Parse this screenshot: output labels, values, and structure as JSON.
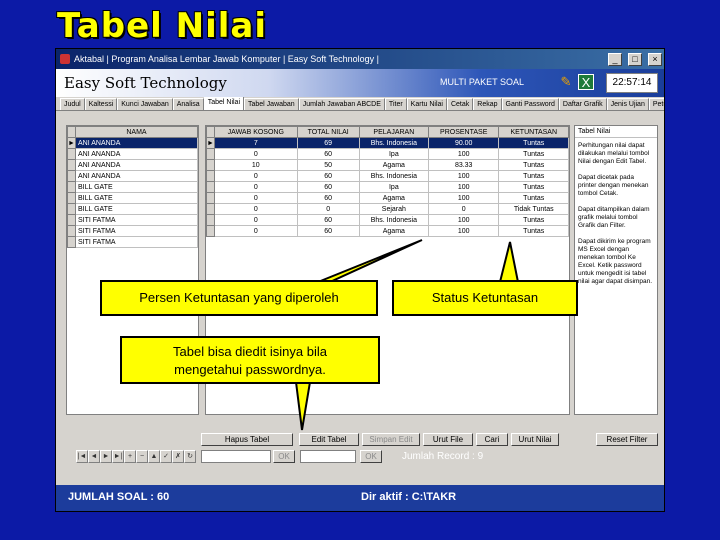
{
  "slide": {
    "title": "Tabel Nilai"
  },
  "window": {
    "title": "Aktabal | Program Analisa Lembar Jawab Komputer | Easy Soft Technology |",
    "minimize": "_",
    "maximize": "□",
    "close": "×"
  },
  "banner": {
    "brand": "Easy Soft Technology",
    "product": "MULTI PAKET SOAL",
    "clock": "22:57:14"
  },
  "tabs": [
    "Judul",
    "Kaltessi",
    "Kunci Jawaban",
    "Analisa",
    "Tabel Nilai",
    "Tabel Jawaban",
    "Jumlah Jawaban ABCDE",
    "Titer",
    "Kartu Nilai",
    "Cetak",
    "Rekap",
    "Ganti Password",
    "Daftar Grafik",
    "Jenis Ujian",
    "Petunjuk"
  ],
  "left_grid": {
    "header": "NAMA",
    "rows": [
      "ANI ANANDA",
      "ANI ANANDA",
      "ANI ANANDA",
      "ANI ANANDA",
      "BILL GATE",
      "BILL GATE",
      "BILL GATE",
      "SITI FATMA",
      "SITI FATMA",
      "SITI FATMA"
    ]
  },
  "main_grid": {
    "columns": [
      "JAWAB KOSONG",
      "TOTAL NILAI",
      "PELAJARAN",
      "PROSENTASE",
      "KETUNTASAN"
    ],
    "rows": [
      [
        "7",
        "69",
        "Bhs. Indonesia",
        "90.00",
        "Tuntas"
      ],
      [
        "0",
        "60",
        "Ipa",
        "100",
        "Tuntas"
      ],
      [
        "10",
        "50",
        "Agama",
        "83.33",
        "Tuntas"
      ],
      [
        "0",
        "60",
        "Bhs. Indonesia",
        "100",
        "Tuntas"
      ],
      [
        "0",
        "60",
        "Ipa",
        "100",
        "Tuntas"
      ],
      [
        "0",
        "60",
        "Agama",
        "100",
        "Tuntas"
      ],
      [
        "0",
        "0",
        "Sejarah",
        "0",
        "Tidak Tuntas"
      ],
      [
        "0",
        "60",
        "Bhs. Indonesia",
        "100",
        "Tuntas"
      ],
      [
        "0",
        "60",
        "Agama",
        "100",
        "Tuntas"
      ]
    ]
  },
  "help": {
    "title": "Tabel Nilai",
    "paragraphs": [
      "Perhitungan nilai dapat dilakukan melalui tombol Nilai dengan Edit Tabel.",
      "Dapat dicetak pada printer dengan menekan tombol Cetak.",
      "Dapat ditampilkan dalam grafik melalui tombol Grafik dan Filter.",
      "Dapat dikirim ke program MS Excel dengan menekan tombol Ke Excel. Ketik password untuk mengedit isi tabel nilai agar dapat disimpan."
    ]
  },
  "buttons": {
    "hapus": "Hapus Tabel",
    "edit": "Edit Tabel",
    "simpan": "Simpan Edit",
    "urut": "Urut File",
    "cari": "Cari",
    "urut_nilai": "Urut Nilai",
    "reset_filter": "Reset Filter",
    "ok1": "OK",
    "ok2": "OK"
  },
  "nav": [
    "|◄",
    "◄",
    "►",
    "►|",
    "+",
    "−",
    "▲",
    "✓",
    "✗",
    "↻"
  ],
  "record_text": "Jumlah Record : 9",
  "status": {
    "left": "JUMLAH SOAL : 60",
    "right": "Dir aktif : C:\\TAKR"
  },
  "callouts": {
    "persen": "Persen Ketuntasan yang diperoleh",
    "status": "Status Ketuntasan",
    "edit_line1": "Tabel bisa diedit isinya bila",
    "edit_line2": "mengetahui passwordnya."
  },
  "colors": {
    "slide_bg": "#0c1aa6",
    "title": "#ffff00",
    "callout": "#ffff00",
    "selected_row": "#0a246a"
  }
}
